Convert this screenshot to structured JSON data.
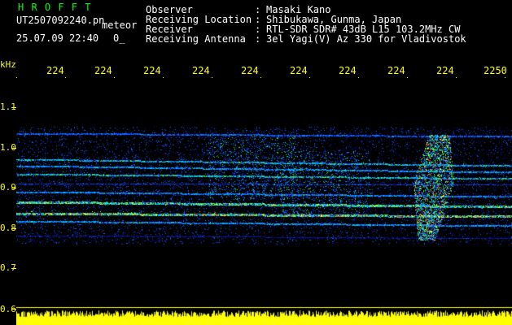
{
  "header": {
    "logo": "H R O F F T",
    "filename": "UT2507092240.pn",
    "type": "meteor",
    "datetime": "25.07.09 22:40",
    "marker": "0_",
    "rows": [
      {
        "label": "Observer",
        "sep": ":",
        "value": "Masaki Kano"
      },
      {
        "label": "Receiving Location",
        "sep": ":",
        "value": "Shibukawa, Gunma, Japan"
      },
      {
        "label": "Receiver",
        "sep": ":",
        "value": "RTL-SDR SDR# 43dB L15 103.2MHz CW"
      },
      {
        "label": "Receiving Antenna",
        "sep": ":",
        "value": "3el Yagi(V) Az 330 for Vladivostok"
      }
    ]
  },
  "axes": {
    "y_unit": "kHz",
    "y_ticks": [
      "1.1",
      "1.0",
      "0.9",
      "0.8",
      "0.7",
      "0.6"
    ],
    "x_ticks": [
      "224",
      "224",
      "224",
      "224",
      "224",
      "224",
      "224",
      "224",
      "224",
      "2250"
    ]
  },
  "colors": {
    "axis": "#ffff00",
    "logo": "#00ff00",
    "text": "#ffffff",
    "background": "#000000"
  }
}
